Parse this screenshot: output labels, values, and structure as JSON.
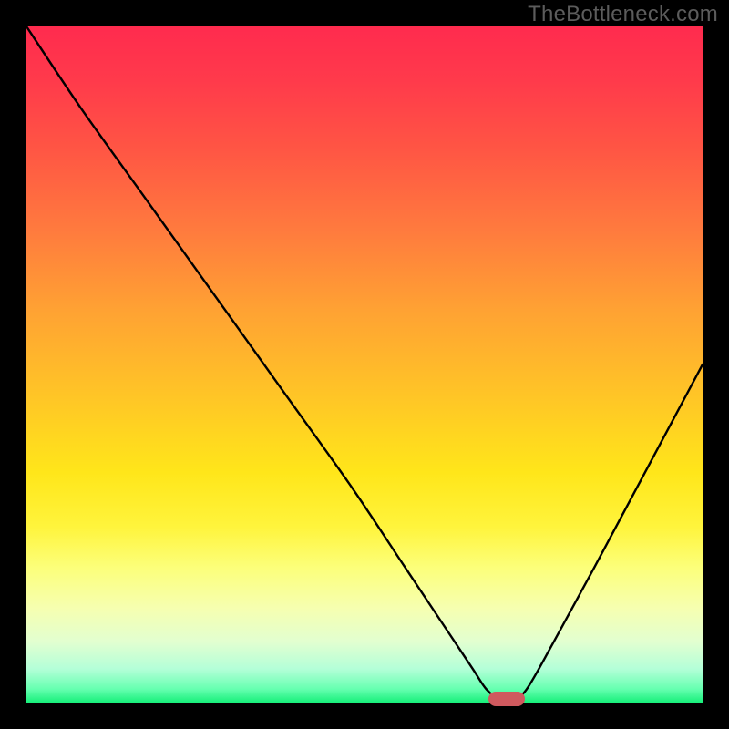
{
  "watermark": "TheBottleneck.com",
  "colors": {
    "frame": "#000000",
    "curve": "#000000",
    "marker": "#cf595e",
    "watermark": "#5c5c5c"
  },
  "chart_data": {
    "type": "line",
    "title": "",
    "xlabel": "",
    "ylabel": "",
    "xlim": [
      0,
      100
    ],
    "ylim": [
      0,
      100
    ],
    "grid": false,
    "series": [
      {
        "name": "bottleneck-curve",
        "x": [
          0,
          8,
          18,
          28,
          38,
          48,
          56,
          62,
          66,
          68,
          70,
          72,
          74,
          78,
          84,
          92,
          100
        ],
        "values": [
          100,
          88,
          74,
          60,
          46,
          32,
          20,
          11,
          5,
          2,
          0.5,
          0.5,
          2,
          9,
          20,
          35,
          50
        ]
      }
    ],
    "annotations": [
      {
        "name": "optimal-marker",
        "x": 71,
        "y": 0.5
      }
    ],
    "background_gradient_stops": [
      {
        "pos": 0.0,
        "color": "#ff2b4e"
      },
      {
        "pos": 0.3,
        "color": "#ff7a3e"
      },
      {
        "pos": 0.55,
        "color": "#ffc626"
      },
      {
        "pos": 0.8,
        "color": "#fcff7a"
      },
      {
        "pos": 0.95,
        "color": "#b4ffd8"
      },
      {
        "pos": 1.0,
        "color": "#17f07a"
      }
    ]
  }
}
